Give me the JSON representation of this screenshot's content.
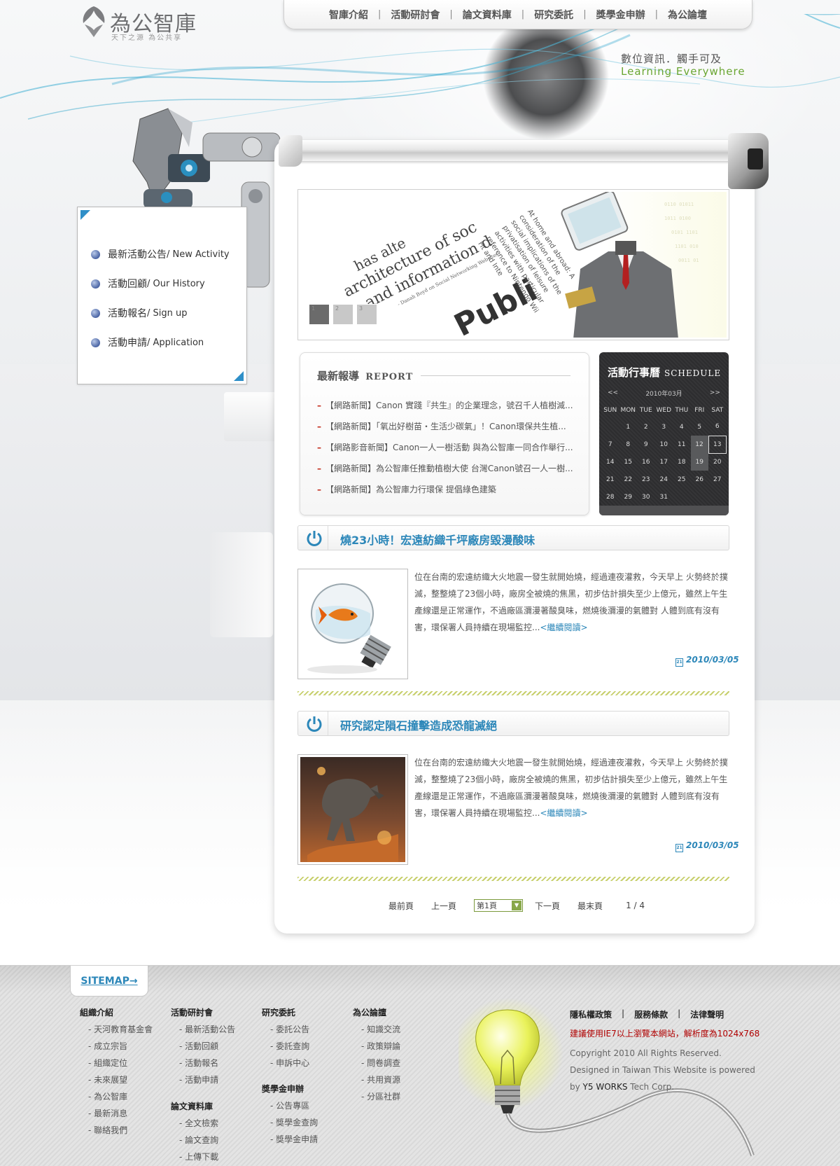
{
  "logo": {
    "title": "為公智庫",
    "subtitle": "天下之源  為公共享"
  },
  "topnav": {
    "items": [
      "智庫介紹",
      "活動研討會",
      "論文資料庫",
      "研究委託",
      "獎學金申辦",
      "為公論壇"
    ],
    "separator": "|"
  },
  "slogan": {
    "line1": "數位資訊．觸手可及",
    "line2": "Learning Everywhere"
  },
  "leftmenu": {
    "items": [
      {
        "zh": "最新活動公告",
        "en": " / New Activity"
      },
      {
        "zh": "活動回顧",
        "en": " / Our History"
      },
      {
        "zh": "活動報名",
        "en": " / Sign up"
      },
      {
        "zh": "活動申請",
        "en": " / Application"
      }
    ]
  },
  "banner": {
    "lines": [
      "has alte",
      "architecture of soc",
      "and information d",
      "- Danah Boyd on Social Networking Websites",
      "Publi"
    ],
    "side_text": "At home and abroad: A consideration of the social implications of the privatisation of leisure activities with particular reference to Nintendo Wii Fit and Inte",
    "dots": [
      "1",
      "2",
      "3"
    ]
  },
  "report": {
    "title": "最新報導",
    "title_en": "REPORT",
    "items": [
      "【網路新聞】Canon 實踐『共生』的企業理念，號召千人植樹減...",
      "【網路新聞】「氧出好樹苗・生活少碳氣」！Canon環保共生植...",
      "【網路影音新聞】Canon一人一樹活動 與為公智庫一同合作舉行...",
      "【網路新聞】為公智庫任推動植樹大使 台灣Canon號召一人一樹...",
      "【網路新聞】為公智庫力行環保 提倡綠色建築"
    ],
    "dash": "–"
  },
  "schedule": {
    "title": "活動行事曆",
    "title_en": "SCHEDULE",
    "prev": "<<",
    "next": ">>",
    "month": "2010年03月",
    "weekdays": [
      "SUN",
      "MON",
      "TUE",
      "WED",
      "THU",
      "FRI",
      "SAT"
    ],
    "weeks": [
      [
        "",
        "1",
        "2",
        "3",
        "4",
        "5",
        "6"
      ],
      [
        "7",
        "8",
        "9",
        "10",
        "11",
        "12",
        "13"
      ],
      [
        "14",
        "15",
        "16",
        "17",
        "18",
        "19",
        "20"
      ],
      [
        "21",
        "22",
        "23",
        "24",
        "25",
        "26",
        "27"
      ],
      [
        "28",
        "29",
        "30",
        "31",
        "",
        "",
        ""
      ]
    ],
    "highlighted": [
      "12",
      "19"
    ],
    "today": "13"
  },
  "articles": [
    {
      "title": "燒23小時！宏遠紡織千坪廠房毀漫酸味",
      "body": "位在台南的宏遠紡織大火地震一發生就開始燒，經過連夜灌救，今天早上 火勢終於撲滅，整整燒了23個小時，廠房全被燒的焦黑，初步估計損失至少上億元，雖然上午生產線還是正常運作，不過廠區瀰漫著酸臭味，燃燒後瀰漫的氣體對 人體到底有沒有害，環保署人員持續在現場監控...",
      "more": "<繼續閱讀>",
      "date": "2010/03/05",
      "image": "goldfish-bulb"
    },
    {
      "title": "研究認定隕石撞擊造成恐龍滅絕",
      "body": "位在台南的宏遠紡織大火地震一發生就開始燒，經過連夜灌救，今天早上 火勢終於撲滅，整整燒了23個小時，廠房全被燒的焦黑，初步估計損失至少上億元，雖然上午生產線還是正常運作，不過廠區瀰漫著酸臭味，燃燒後瀰漫的氣體對 人體到底有沒有害，環保署人員持續在現場監控...",
      "more": "<繼續閱讀>",
      "date": "2010/03/05",
      "image": "dinosaur"
    }
  ],
  "pager": {
    "first": "最前頁",
    "prev": "上一頁",
    "select": "第1頁",
    "next": "下一頁",
    "last": "最末頁",
    "count": "1 / 4"
  },
  "footer": {
    "sitemap": "SITEMAP→",
    "columns": [
      {
        "heading": "組織介紹",
        "links": [
          "- 天河教育基金會",
          "- 成立宗旨",
          "- 組織定位",
          "- 未來展望",
          "- 為公智庫",
          "- 最新消息",
          "- 聯絡我們"
        ]
      },
      {
        "heading": "活動研討會",
        "links": [
          "- 最新活動公告",
          "- 活動回顧",
          "- 活動報名",
          "- 活動申請"
        ]
      },
      {
        "heading": "論文資料庫",
        "links": [
          "- 全文檢索",
          "- 論文查詢",
          "- 上傳下載"
        ]
      },
      {
        "heading": "研究委託",
        "links": [
          "- 委託公告",
          "- 委託查詢",
          "- 申訴中心"
        ]
      },
      {
        "heading": "獎學金申辦",
        "links": [
          "- 公告專區",
          "- 獎學金查詢",
          "- 獎學金申請"
        ]
      },
      {
        "heading": "為公論譠",
        "links": [
          "- 知識交流",
          "- 政策辯論",
          "- 問卷調查",
          "- 共用資源",
          "- 分區社群"
        ]
      }
    ],
    "legal": [
      "隱私權政策",
      "|",
      "服務條款",
      "|",
      "法律聲明"
    ],
    "notice": "建議使用IE7以上瀏覽本網站，解析度為1024x768",
    "copyright": "Copyright 2010 All Rights Reserved.",
    "designed": "Designed in Taiwan This Website is powered",
    "by": "by ",
    "brand": "Y5 WORKS",
    "corp": " Tech Corp."
  },
  "colors": {
    "accent": "#2c87b9",
    "green": "#6aa632",
    "notice": "#b00000",
    "dash": "#c32a1a"
  }
}
